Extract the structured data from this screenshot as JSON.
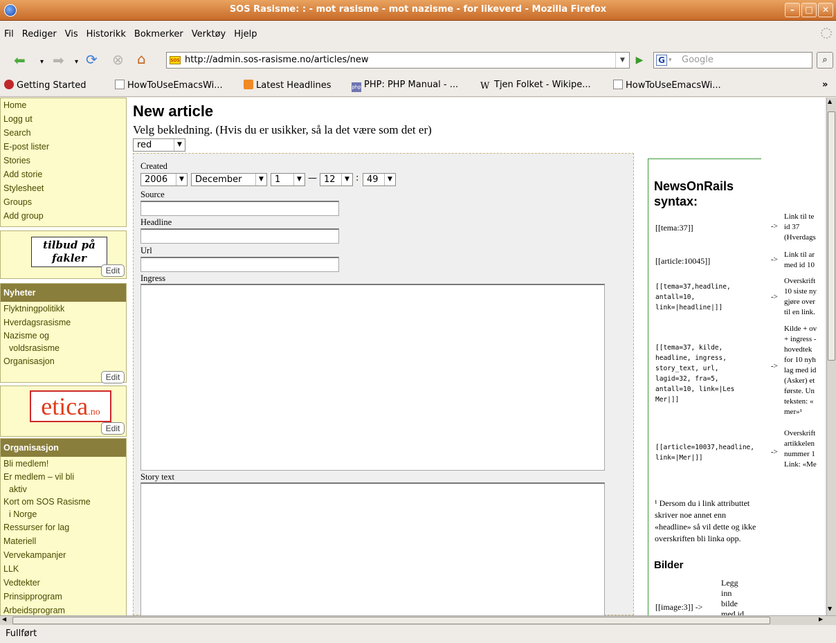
{
  "window": {
    "title": "SOS Rasisme: : - mot rasisme - mot nazisme - for likeverd - Mozilla Firefox"
  },
  "menu": [
    "Fil",
    "Rediger",
    "Vis",
    "Historikk",
    "Bokmerker",
    "Verktøy",
    "Hjelp"
  ],
  "nav": {
    "url": "http://admin.sos-rasisme.no/articles/new",
    "search_placeholder": "Google"
  },
  "bookmarks": [
    {
      "label": "Getting Started",
      "icon": "firefox-icon"
    },
    {
      "label": "HowToUseEmacsWi...",
      "icon": "page-icon"
    },
    {
      "label": "Latest Headlines",
      "icon": "rss-icon"
    },
    {
      "label": "PHP: PHP Manual - ...",
      "icon": "php-icon"
    },
    {
      "label": "Tjen Folket - Wikipe...",
      "icon": "wikipedia-icon"
    },
    {
      "label": "HowToUseEmacsWi...",
      "icon": "page-icon"
    }
  ],
  "sidebar": {
    "admin_links": [
      "Home",
      "Logg ut",
      "Search",
      "E-post lister",
      "Stories",
      "Add storie",
      "Stylesheet",
      "Groups",
      "Add group"
    ],
    "banner1": {
      "line1": "tilbud på",
      "line2": "fakler"
    },
    "edit_label": "Edit",
    "nyheter_title": "Nyheter",
    "nyheter_links": [
      "Flyktningpolitikk",
      "Hverdagsrasisme",
      "Nazisme og",
      "voldsrasisme",
      "Organisasjon"
    ],
    "banner2": {
      "text": "etica",
      "suffix": ".no"
    },
    "org_title": "Organisasjon",
    "org_links": [
      "Bli medlem!",
      "Er medlem – vil bli",
      "aktiv",
      "Kort om SOS Rasisme",
      "i Norge",
      "Ressurser for lag",
      "Materiell",
      "Vervekampanjer",
      "LLK",
      "Vedtekter",
      "Prinsipprogram",
      "Arbeidsprogram"
    ]
  },
  "main": {
    "title": "New article",
    "intro": "Velg bekledning. (Hvis du er usikker, så la det være som det er)",
    "theme_value": "red",
    "created_label": "Created",
    "date": {
      "year": "2006",
      "month": "December",
      "day": "1",
      "dash": "—",
      "hour": "12",
      "colon": ":",
      "minute": "49"
    },
    "source_label": "Source",
    "headline_label": "Headline",
    "url_label": "Url",
    "ingress_label": "Ingress",
    "story_label": "Story text"
  },
  "syntax": {
    "title_line1": "NewsOnRails",
    "title_line2": "syntax:",
    "rows": [
      {
        "code": "[[tema:37]]",
        "arrow": "->",
        "desc": [
          "Link til te",
          "id 37",
          "(Hverdags"
        ]
      },
      {
        "code": "[[article:10045]]",
        "arrow": "->",
        "desc": [
          "Link til ar",
          "med id 10"
        ]
      },
      {
        "code": [
          "[[tema=37,headline,",
          "antall=10,",
          "link=|headline|]]"
        ],
        "arrow": "->",
        "desc": [
          "Overskrift",
          "10 siste ny",
          "gjøre over",
          "til en link."
        ]
      },
      {
        "code": [
          "[[tema=37, kilde,",
          "headline, ingress,",
          "story_text, url,",
          "lagid=32, fra=5,",
          "antall=10, link=|Les",
          "Mer|]]"
        ],
        "arrow": "->",
        "desc": [
          "Kilde + ov",
          "+ ingress -",
          "hovedtek",
          "for 10 nyh",
          "lag med id",
          "(Asker) et",
          "første. Un",
          "teksten: «",
          "mer»¹"
        ]
      },
      {
        "code": [
          "[[article=10037,headline,",
          "link=|Mer|]]"
        ],
        "arrow": "->",
        "desc": [
          "Overskrift",
          "artikkelen",
          "nummer 1",
          "Link: «Me"
        ]
      }
    ],
    "footnote": "¹ Dersom du i link attributtet skriver noe annet enn «headline» så vil dette og ikke overskriften bli linka opp.",
    "bilder_title": "Bilder",
    "bilder_code": "[[image:3]] ->",
    "bilder_desc": [
      "Legg",
      "inn",
      "bilde",
      "med id"
    ]
  },
  "status": {
    "text": "Fullført"
  }
}
